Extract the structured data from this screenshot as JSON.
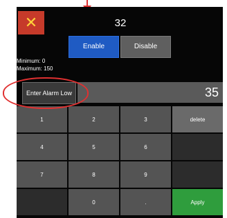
{
  "header": {
    "close_symbol": "✕",
    "value": "32"
  },
  "toggle": {
    "enable_label": "Enable",
    "disable_label": "Disable",
    "selected": "Enable",
    "selected_color": "#1f5bc3"
  },
  "limits": {
    "minimum": "Minimum: 0",
    "maximum": "Maximum: 150"
  },
  "entry": {
    "label": "Enter Alarm Low",
    "value": "35"
  },
  "keypad": {
    "k1": "1",
    "k2": "2",
    "k3": "3",
    "delete": "delete",
    "k4": "4",
    "k5": "5",
    "k6": "6",
    "k7": "7",
    "k8": "8",
    "k9": "9",
    "k0": "0",
    "dot": ".",
    "apply": "Apply",
    "apply_color": "#2f9d3d"
  },
  "annotations": {
    "arrow_color": "#e03131",
    "ring_color": "#e03131"
  }
}
